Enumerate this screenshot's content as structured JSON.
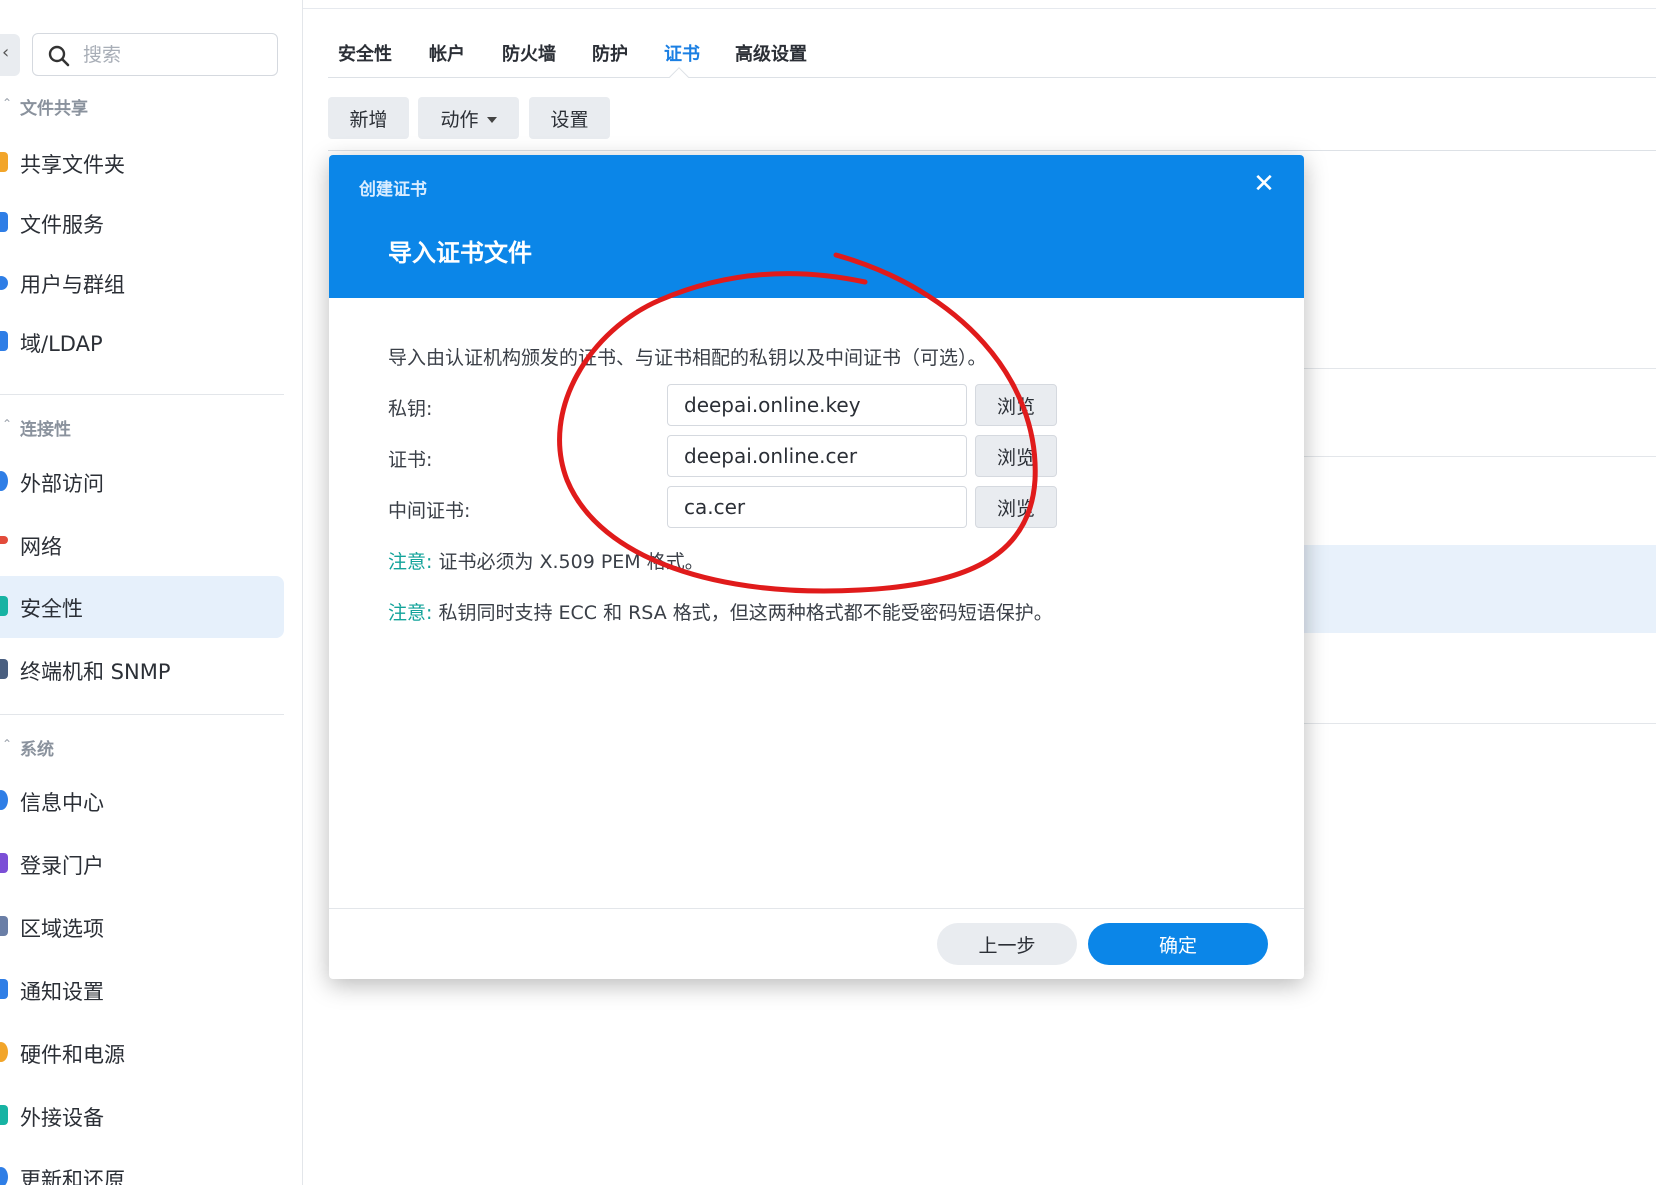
{
  "search": {
    "placeholder": "搜索"
  },
  "sidebar": {
    "sections": [
      {
        "label": "文件共享"
      },
      {
        "label": "连接性"
      },
      {
        "label": "系统"
      }
    ],
    "items": [
      {
        "label": "共享文件夹",
        "color": "#f2a52a"
      },
      {
        "label": "文件服务",
        "color": "#2f7ee6"
      },
      {
        "label": "用户与群组",
        "color": "#2f7ee6"
      },
      {
        "label": "域/LDAP",
        "color": "#2f7ee6"
      },
      {
        "label": "外部访问",
        "color": "#2f7ee6"
      },
      {
        "label": "网络",
        "color": "#e24b3b"
      },
      {
        "label": "安全性",
        "color": "#17b3a3"
      },
      {
        "label": "终端机和 SNMP",
        "color": "#4a5f80"
      },
      {
        "label": "信息中心",
        "color": "#2f7ee6"
      },
      {
        "label": "登录门户",
        "color": "#7b4fd6"
      },
      {
        "label": "区域选项",
        "color": "#6a7ea6"
      },
      {
        "label": "通知设置",
        "color": "#2f7ee6"
      },
      {
        "label": "硬件和电源",
        "color": "#f2a52a"
      },
      {
        "label": "外接设备",
        "color": "#17b3a3"
      },
      {
        "label": "更新和还原",
        "color": "#2f7ee6"
      }
    ],
    "active_item": "安全性"
  },
  "tabs": [
    "安全性",
    "帐户",
    "防火墙",
    "防护",
    "证书",
    "高级设置"
  ],
  "active_tab": "证书",
  "toolbar": {
    "add": "新增",
    "action": "动作",
    "settings": "设置"
  },
  "dialog": {
    "title": "创建证书",
    "subtitle": "导入证书文件",
    "close_icon": "close-icon",
    "description": "导入由认证机构颁发的证书、与证书相配的私钥以及中间证书（可选）。",
    "fields": [
      {
        "label": "私钥:",
        "value": "deepai.online.key",
        "button": "浏览"
      },
      {
        "label": "证书:",
        "value": "deepai.online.cer",
        "button": "浏览"
      },
      {
        "label": "中间证书:",
        "value": "ca.cer",
        "button": "浏览"
      }
    ],
    "notes": [
      {
        "prefix": "注意:",
        "text": " 证书必须为 X.509 PEM 格式。"
      },
      {
        "prefix": "注意:",
        "text": " 私钥同时支持 ECC 和 RSA 格式，但这两种格式都不能受密码短语保护。"
      }
    ],
    "prev_button": "上一步",
    "ok_button": "确定"
  },
  "colors": {
    "accent": "#0b86e8",
    "annotation": "#e01b1b",
    "note": "#12a39a"
  }
}
